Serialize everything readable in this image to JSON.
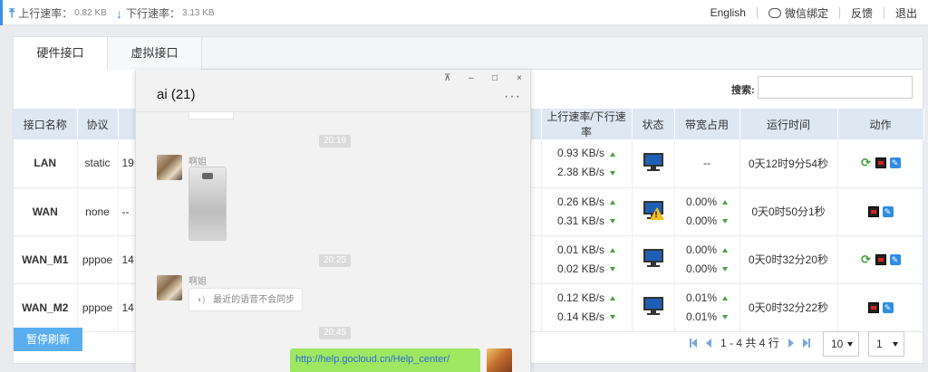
{
  "topbar": {
    "upload_label": "上行速率：",
    "upload_value": "0.82 KB",
    "download_label": "下行速率：",
    "download_value": "3.13 KB",
    "nav": {
      "english": "English",
      "wechat": "微信绑定",
      "feedback": "反馈",
      "logout": "退出"
    }
  },
  "tabs": [
    "硬件接口",
    "虚拟接口"
  ],
  "search": {
    "label": "搜索:",
    "placeholder": ""
  },
  "table": {
    "headers": [
      "接口名称",
      "协议",
      "",
      "上行速率/下行速率",
      "状态",
      "带宽占用",
      "运行时间",
      "动作"
    ],
    "rows": [
      {
        "name": "LAN",
        "protocol": "static",
        "ip": "19.",
        "up": "0.93 KB/s",
        "down": "2.38 KB/s",
        "status": "ok",
        "bw_up": "--",
        "bw_down": "",
        "uptime": "0天12时9分54秒"
      },
      {
        "name": "WAN",
        "protocol": "none",
        "ip": "--",
        "up": "0.26 KB/s",
        "down": "0.31 KB/s",
        "status": "warning",
        "bw_up": "0.00%",
        "bw_down": "0.00%",
        "uptime": "0天0时50分1秒"
      },
      {
        "name": "WAN_M1",
        "protocol": "pppoe",
        "ip": "14.",
        "up": "0.01 KB/s",
        "down": "0.02 KB/s",
        "status": "ok",
        "bw_up": "0.00%",
        "bw_down": "0.00%",
        "uptime": "0天0时32分20秒"
      },
      {
        "name": "WAN_M2",
        "protocol": "pppoe",
        "ip": "14.",
        "up": "0.12 KB/s",
        "down": "0.14 KB/s",
        "status": "ok",
        "bw_up": "0.01%",
        "bw_down": "0.01%",
        "uptime": "0天0时32分22秒"
      }
    ]
  },
  "pause_button": "暂停刷新",
  "pager": {
    "summary": "1 - 4 共 4 行",
    "page_size": "10",
    "page": "1"
  },
  "chat": {
    "title": "ai (21)",
    "window_buttons": {
      "pin": "⊼",
      "min": "–",
      "max": "□",
      "close": "×"
    },
    "more": "···",
    "messages": [
      {
        "time": "20:19",
        "sender": "啊姐",
        "type": "image"
      },
      {
        "time": "20:25",
        "sender": "啊姐",
        "type": "voice",
        "text": "最近的语音不会同步"
      },
      {
        "time": "20:45",
        "type": "link",
        "text": "http://help.gocloud.cn/Help_center/"
      }
    ]
  },
  "colors": {
    "accent": "#3a8ee6",
    "header_bg": "#dde8f3",
    "pause_button": "#5aaef0",
    "chat_bubble_self": "#9ee761",
    "rate_arrow": "#4aa340"
  }
}
